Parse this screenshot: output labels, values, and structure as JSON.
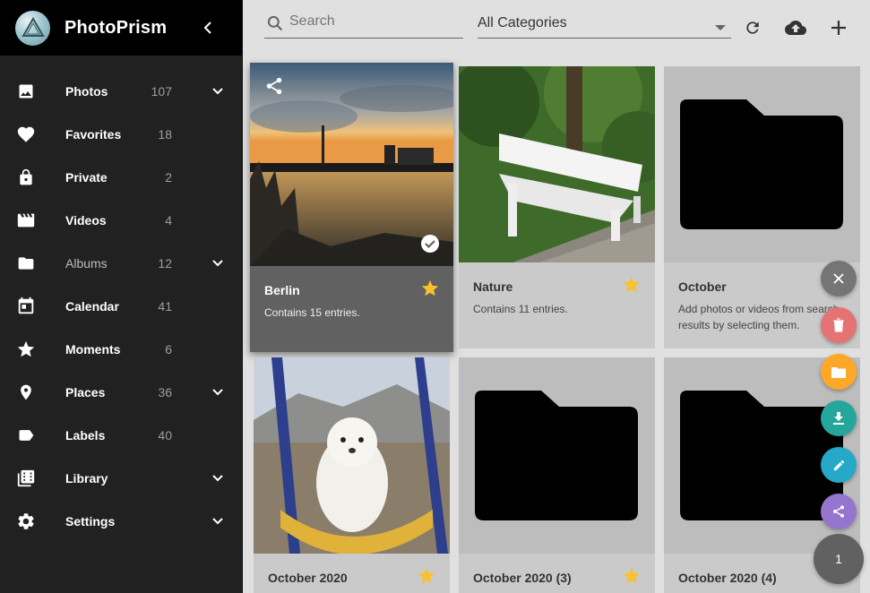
{
  "app": {
    "title": "PhotoPrism"
  },
  "sidebar": {
    "items": [
      {
        "label": "Photos",
        "count": "107",
        "icon": "image-icon",
        "chevron": true,
        "dim": false
      },
      {
        "label": "Favorites",
        "count": "18",
        "icon": "heart-icon",
        "chevron": false,
        "dim": false
      },
      {
        "label": "Private",
        "count": "2",
        "icon": "lock-icon",
        "chevron": false,
        "dim": false
      },
      {
        "label": "Videos",
        "count": "4",
        "icon": "movie-icon",
        "chevron": false,
        "dim": false
      },
      {
        "label": "Albums",
        "count": "12",
        "icon": "folder-icon",
        "chevron": true,
        "dim": true
      },
      {
        "label": "Calendar",
        "count": "41",
        "icon": "calendar-icon",
        "chevron": false,
        "dim": false
      },
      {
        "label": "Moments",
        "count": "6",
        "icon": "star-icon",
        "chevron": false,
        "dim": false
      },
      {
        "label": "Places",
        "count": "36",
        "icon": "place-icon",
        "chevron": true,
        "dim": false
      },
      {
        "label": "Labels",
        "count": "40",
        "icon": "label-icon",
        "chevron": false,
        "dim": false
      },
      {
        "label": "Library",
        "count": "",
        "icon": "library-icon",
        "chevron": true,
        "dim": false
      },
      {
        "label": "Settings",
        "count": "",
        "icon": "gear-icon",
        "chevron": true,
        "dim": false
      }
    ]
  },
  "toolbar": {
    "search_placeholder": "Search",
    "category": "All Categories"
  },
  "albums": [
    {
      "title": "Berlin",
      "desc": "Contains 15 entries.",
      "starred": true,
      "selected": true,
      "thumb": "sunset"
    },
    {
      "title": "Nature",
      "desc": "Contains 11 entries.",
      "starred": true,
      "selected": false,
      "thumb": "bench"
    },
    {
      "title": "October",
      "desc": "Add photos or videos from search results by selecting them.",
      "starred": false,
      "selected": false,
      "thumb": "folder"
    },
    {
      "title": "October 2020",
      "desc": "",
      "starred": true,
      "selected": false,
      "thumb": "dog"
    },
    {
      "title": "October 2020 (3)",
      "desc": "",
      "starred": true,
      "selected": false,
      "thumb": "folder"
    },
    {
      "title": "October 2020 (4)",
      "desc": "",
      "starred": false,
      "selected": false,
      "thumb": "folder"
    }
  ],
  "fab": {
    "selection_count": "1"
  },
  "colors": {
    "star": "#fbc02d",
    "fab_close": "#757575",
    "fab_delete": "#e57373",
    "fab_album": "#ffa726",
    "fab_download": "#26a69a",
    "fab_edit": "#26a9c9",
    "fab_share": "#9575cd",
    "fab_count": "#616161"
  }
}
